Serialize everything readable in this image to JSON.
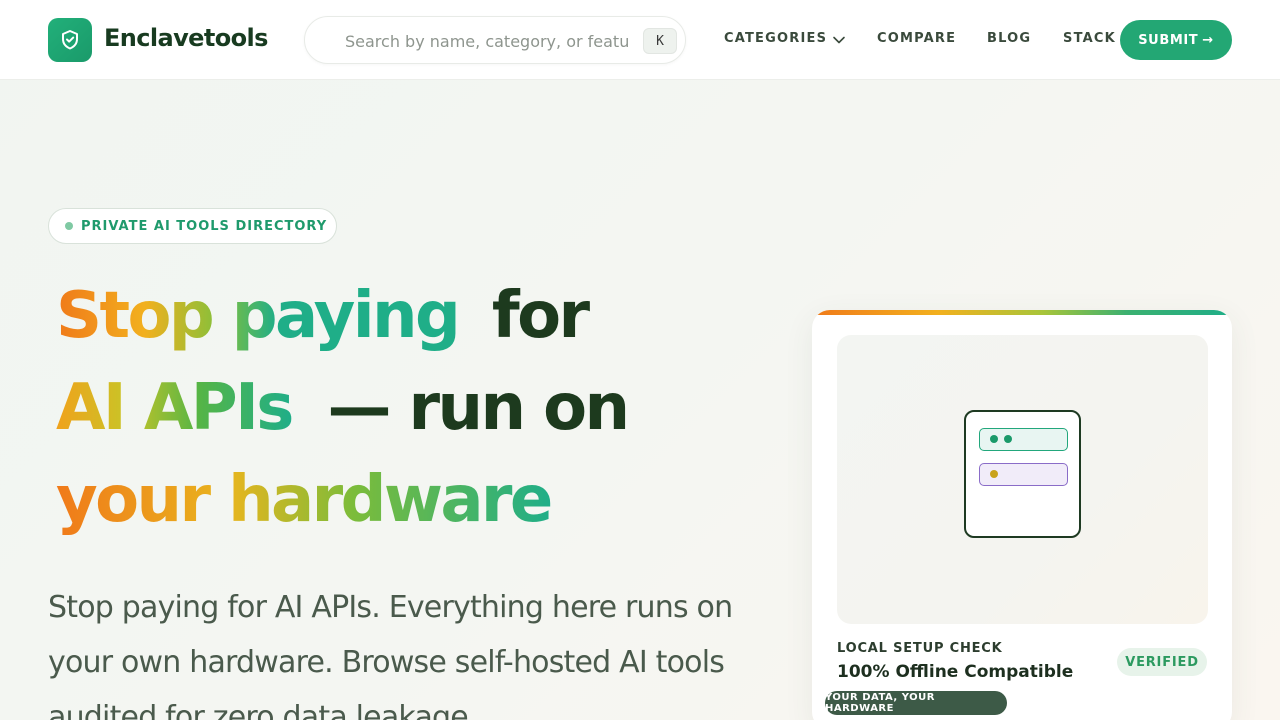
{
  "header": {
    "brand": "Enclavetools",
    "search": {
      "placeholder": "Search by name, category, or featu",
      "shortcut": "K"
    },
    "nav": {
      "categories": "CATEGORIES",
      "compare": "COMPARE",
      "blog": "BLOG",
      "stack": "STACK"
    },
    "submit_label": "SUBMIT",
    "submit_arrow": "→"
  },
  "hero": {
    "badge": "PRIVATE AI TOOLS DIRECTORY",
    "headline": {
      "line1_grad": "Stop paying",
      "line1_dark": "for",
      "line2_grad": "AI APIs",
      "line2_dark": "— run on",
      "line3_grad": "your hardware"
    },
    "description": "Stop paying for AI APIs. Everything here runs on your own hardware. Browse self-hosted AI tools audited for zero data leakage."
  },
  "card": {
    "label": "LOCAL SETUP CHECK",
    "title": "100% Offline Compatible",
    "status": "VERIFIED",
    "tag": "YOUR DATA, YOUR HARDWARE"
  },
  "colors": {
    "brand_green": "#23a774",
    "dark_text": "#1d3a1e",
    "accent_purple": "#8a6cc8"
  }
}
